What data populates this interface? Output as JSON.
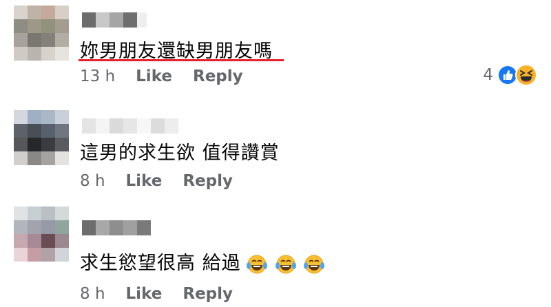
{
  "comments": [
    {
      "text": "妳男朋友還缺男朋友嗎",
      "time": "13 h",
      "like_label": "Like",
      "reply_label": "Reply",
      "reaction_count": "4",
      "reactions": [
        "like-icon",
        "laugh-icon"
      ],
      "highlight_color": "#e8202a"
    },
    {
      "text": "這男的求生欲 值得讚賞",
      "time": "8 h",
      "like_label": "Like",
      "reply_label": "Reply"
    },
    {
      "text": "求生慾望很高 給過",
      "emojis": [
        "tears-of-joy-icon",
        "tears-of-joy-icon",
        "tears-of-joy-icon"
      ],
      "time": "8 h",
      "like_label": "Like",
      "reply_label": "Reply"
    }
  ],
  "colors": {
    "meta_text": "#65676b",
    "body_text": "#050505",
    "like_blue": "#1877f2",
    "laugh_yellow": "#f7b125"
  }
}
